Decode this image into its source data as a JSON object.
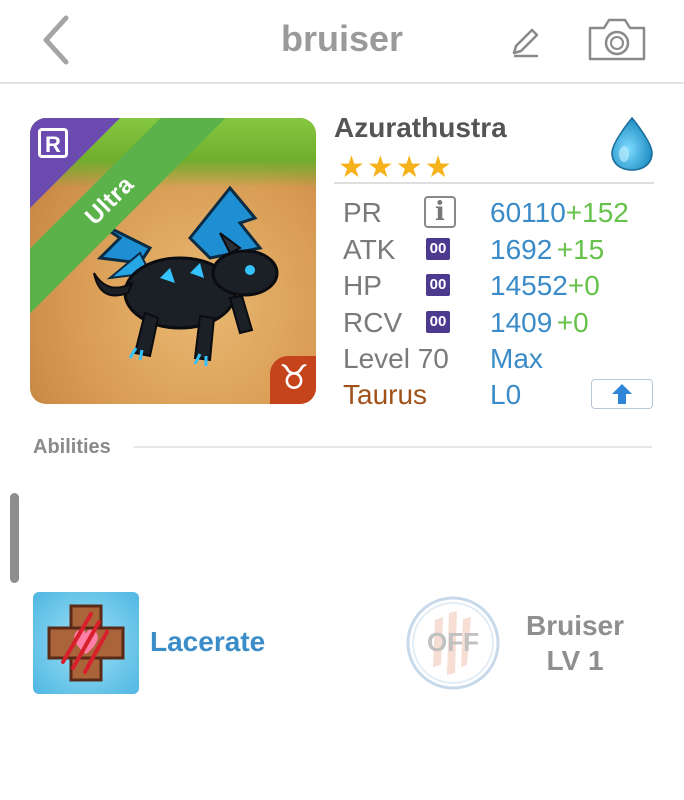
{
  "header": {
    "title": "bruiser",
    "back_icon": "chevron-left-icon",
    "edit_icon": "pencil-icon",
    "camera_icon": "camera-icon"
  },
  "monster": {
    "name": "Azurathustra",
    "rarity": "Ultra",
    "rarity_badge": "R",
    "stars": "★★★★",
    "star_count": 4,
    "element_icon": "water-drop-icon",
    "zodiac_glyph": "♉",
    "zodiac": "Taurus",
    "zodiac_level": "L0"
  },
  "stats": [
    {
      "label": "PR",
      "value": "60110",
      "bonus": "+152",
      "badge": "i"
    },
    {
      "label": "ATK",
      "value": "1692",
      "bonus": "+15",
      "badge": "00"
    },
    {
      "label": "HP",
      "value": "14552",
      "bonus": "+0",
      "badge": "00"
    },
    {
      "label": "RCV",
      "value": "1409",
      "bonus": "+0",
      "badge": "00"
    }
  ],
  "level": {
    "label": "Level 70",
    "value": "Max"
  },
  "abilities": {
    "section_label": "Abilities",
    "items": [
      {
        "name": "Lacerate",
        "icon": "heart-cross-icon"
      }
    ],
    "toggle_label": "OFF",
    "bruiser_name": "Bruiser",
    "bruiser_level": "LV 1"
  },
  "colors": {
    "accent_blue": "#3a8bc8",
    "bonus_green": "#66c24b",
    "star_gold": "#f6b21a",
    "rarity_green": "#5cb24a",
    "taurus_brown": "#a0521a"
  }
}
